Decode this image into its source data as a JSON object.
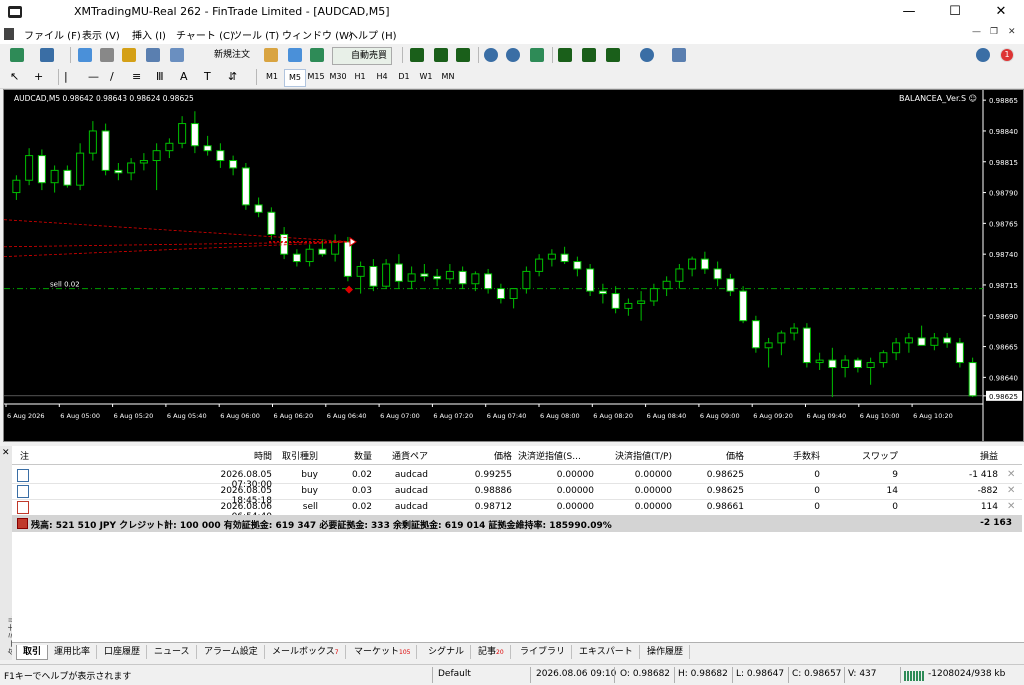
{
  "window": {
    "title": "XMTradingMU-Real 262 - FinTrade Limited - [AUDCAD,M5]",
    "minimize": "—",
    "maximize": "☐",
    "close": "✕"
  },
  "menu": [
    "ファイル (F)",
    "表示 (V)",
    "挿入 (I)",
    "チャート (C)",
    "ツール (T)",
    "ウィンドウ (W)",
    "ヘルプ (H)"
  ],
  "mdi": {
    "min": "—",
    "restore": "❐",
    "close": "✕"
  },
  "toolbar": {
    "new_order": "新規注文",
    "autotrade": "自動売買",
    "notify_count": "1"
  },
  "timeframes": [
    "M1",
    "M5",
    "M15",
    "M30",
    "H1",
    "H4",
    "D1",
    "W1",
    "MN"
  ],
  "timeframe_active": "M5",
  "chart": {
    "info": "AUDCAD,M5  0.98642 0.98643 0.98624 0.98625",
    "ea": "BALANCEA_Ver.S ☺",
    "sell_label": "sell 0.02",
    "current_price": "0.98625",
    "sell_price": 0.98712,
    "price_labels": [
      "0.98865",
      "0.98840",
      "0.98815",
      "0.98790",
      "0.98765",
      "0.98740",
      "0.98715",
      "0.98690",
      "0.98665",
      "0.98640",
      "0.98625"
    ],
    "time_labels": [
      "6 Aug 2026",
      "6 Aug 05:00",
      "6 Aug 05:20",
      "6 Aug 05:40",
      "6 Aug 06:00",
      "6 Aug 06:20",
      "6 Aug 06:40",
      "6 Aug 07:00",
      "6 Aug 07:20",
      "6 Aug 07:40",
      "6 Aug 08:00",
      "6 Aug 08:20",
      "6 Aug 08:40",
      "6 Aug 09:00",
      "6 Aug 09:20",
      "6 Aug 09:40",
      "6 Aug 10:00",
      "6 Aug 10:20"
    ],
    "ohlc": [
      [
        0.9879,
        0.98804,
        0.98784,
        0.988
      ],
      [
        0.988,
        0.98826,
        0.98796,
        0.9882
      ],
      [
        0.9882,
        0.98825,
        0.98792,
        0.98798
      ],
      [
        0.98798,
        0.98812,
        0.9879,
        0.98808
      ],
      [
        0.98808,
        0.98812,
        0.98794,
        0.98796
      ],
      [
        0.98796,
        0.9883,
        0.98792,
        0.98822
      ],
      [
        0.98822,
        0.98848,
        0.98816,
        0.9884
      ],
      [
        0.9884,
        0.98846,
        0.98804,
        0.98808
      ],
      [
        0.98808,
        0.98814,
        0.988,
        0.98806
      ],
      [
        0.98806,
        0.98818,
        0.988,
        0.98814
      ],
      [
        0.98814,
        0.98822,
        0.98808,
        0.98816
      ],
      [
        0.98816,
        0.9883,
        0.98792,
        0.98824
      ],
      [
        0.98824,
        0.98834,
        0.98818,
        0.9883
      ],
      [
        0.9883,
        0.98852,
        0.98826,
        0.98846
      ],
      [
        0.98846,
        0.98856,
        0.98822,
        0.98828
      ],
      [
        0.98828,
        0.98836,
        0.9882,
        0.98824
      ],
      [
        0.98824,
        0.9883,
        0.9881,
        0.98816
      ],
      [
        0.98816,
        0.9882,
        0.98804,
        0.9881
      ],
      [
        0.9881,
        0.98814,
        0.98776,
        0.9878
      ],
      [
        0.9878,
        0.98786,
        0.9877,
        0.98774
      ],
      [
        0.98774,
        0.98778,
        0.98752,
        0.98756
      ],
      [
        0.98756,
        0.98762,
        0.98736,
        0.9874
      ],
      [
        0.9874,
        0.98744,
        0.9873,
        0.98734
      ],
      [
        0.98734,
        0.98748,
        0.9873,
        0.98744
      ],
      [
        0.98744,
        0.98752,
        0.98738,
        0.9874
      ],
      [
        0.9874,
        0.98756,
        0.98734,
        0.9875
      ],
      [
        0.9875,
        0.98754,
        0.98718,
        0.98722
      ],
      [
        0.98722,
        0.98734,
        0.98708,
        0.9873
      ],
      [
        0.9873,
        0.98736,
        0.9871,
        0.98714
      ],
      [
        0.98714,
        0.98736,
        0.98712,
        0.98732
      ],
      [
        0.98732,
        0.9874,
        0.98712,
        0.98718
      ],
      [
        0.98718,
        0.9873,
        0.98712,
        0.98724
      ],
      [
        0.98724,
        0.98732,
        0.98718,
        0.98722
      ],
      [
        0.98722,
        0.98728,
        0.98714,
        0.9872
      ],
      [
        0.9872,
        0.98732,
        0.98716,
        0.98726
      ],
      [
        0.98726,
        0.9873,
        0.98712,
        0.98716
      ],
      [
        0.98716,
        0.98726,
        0.9871,
        0.98724
      ],
      [
        0.98724,
        0.98728,
        0.98708,
        0.98712
      ],
      [
        0.98712,
        0.98716,
        0.987,
        0.98704
      ],
      [
        0.98704,
        0.98712,
        0.98696,
        0.98712
      ],
      [
        0.98712,
        0.9873,
        0.98708,
        0.98726
      ],
      [
        0.98726,
        0.9874,
        0.98722,
        0.98736
      ],
      [
        0.98736,
        0.98744,
        0.9873,
        0.9874
      ],
      [
        0.9874,
        0.98746,
        0.98732,
        0.98734
      ],
      [
        0.98734,
        0.98738,
        0.98722,
        0.98728
      ],
      [
        0.98728,
        0.98732,
        0.98706,
        0.9871
      ],
      [
        0.9871,
        0.98716,
        0.987,
        0.98708
      ],
      [
        0.98708,
        0.98714,
        0.98692,
        0.98696
      ],
      [
        0.98696,
        0.98704,
        0.9869,
        0.987
      ],
      [
        0.987,
        0.9871,
        0.98686,
        0.98702
      ],
      [
        0.98702,
        0.98716,
        0.98698,
        0.98712
      ],
      [
        0.98712,
        0.98722,
        0.98706,
        0.98718
      ],
      [
        0.98718,
        0.98732,
        0.98712,
        0.98728
      ],
      [
        0.98728,
        0.98738,
        0.98722,
        0.98736
      ],
      [
        0.98736,
        0.98742,
        0.98724,
        0.98728
      ],
      [
        0.98728,
        0.98734,
        0.98714,
        0.9872
      ],
      [
        0.9872,
        0.98724,
        0.98706,
        0.9871
      ],
      [
        0.9871,
        0.98714,
        0.98684,
        0.98686
      ],
      [
        0.98686,
        0.9869,
        0.9866,
        0.98664
      ],
      [
        0.98664,
        0.98672,
        0.98648,
        0.98668
      ],
      [
        0.98668,
        0.98678,
        0.98658,
        0.98676
      ],
      [
        0.98676,
        0.98684,
        0.9867,
        0.9868
      ],
      [
        0.9868,
        0.98684,
        0.98648,
        0.98652
      ],
      [
        0.98652,
        0.9866,
        0.98646,
        0.98654
      ],
      [
        0.98654,
        0.98664,
        0.98624,
        0.98648
      ],
      [
        0.98648,
        0.98658,
        0.9864,
        0.98654
      ],
      [
        0.98654,
        0.98656,
        0.98644,
        0.98648
      ],
      [
        0.98648,
        0.98656,
        0.98634,
        0.98652
      ],
      [
        0.98652,
        0.98662,
        0.98648,
        0.9866
      ],
      [
        0.9866,
        0.98672,
        0.98654,
        0.98668
      ],
      [
        0.98668,
        0.98676,
        0.9866,
        0.98672
      ],
      [
        0.98672,
        0.98682,
        0.98666,
        0.98666
      ],
      [
        0.98666,
        0.98676,
        0.98662,
        0.98672
      ],
      [
        0.98672,
        0.98676,
        0.98664,
        0.98668
      ],
      [
        0.98668,
        0.98672,
        0.98648,
        0.98652
      ],
      [
        0.98652,
        0.98656,
        0.98624,
        0.98625
      ]
    ]
  },
  "table": {
    "headers": [
      "注",
      "時間",
      "取引種別",
      "数量",
      "通貨ペア",
      "価格",
      "決済逆指値(S...",
      "決済指値(T/P)",
      "価格",
      "手数料",
      "スワップ",
      "損益"
    ],
    "rows": [
      [
        "",
        "2026.08.05 07:30:00",
        "buy",
        "0.02",
        "audcad",
        "0.99255",
        "0.00000",
        "0.00000",
        "0.98625",
        "0",
        "9",
        "-1 418"
      ],
      [
        "",
        "2026.08.05 18:45:18",
        "buy",
        "0.03",
        "audcad",
        "0.98886",
        "0.00000",
        "0.00000",
        "0.98625",
        "0",
        "14",
        "-882"
      ],
      [
        "",
        "2026.08.06 06:54:40",
        "sell",
        "0.02",
        "audcad",
        "0.98712",
        "0.00000",
        "0.00000",
        "0.98661",
        "0",
        "0",
        "114"
      ]
    ],
    "summary": "残高: 521 510 JPY  クレジット計: 100 000  有効証拠金: 619 347  必要証拠金: 333  余剰証拠金: 619 014  証拠金維持率: 185990.09%",
    "summary_total": "-2 163"
  },
  "terminal_label": "ターミナル",
  "tabs": [
    {
      "label": "取引",
      "badge": ""
    },
    {
      "label": "運用比率",
      "badge": ""
    },
    {
      "label": "口座履歴",
      "badge": ""
    },
    {
      "label": "ニュース",
      "badge": ""
    },
    {
      "label": "アラーム設定",
      "badge": ""
    },
    {
      "label": "メールボックス",
      "badge": "7"
    },
    {
      "label": "マーケット",
      "badge": "105"
    },
    {
      "label": "シグナル",
      "badge": ""
    },
    {
      "label": "記事",
      "badge": "20"
    },
    {
      "label": "ライブラリ",
      "badge": ""
    },
    {
      "label": "エキスパート",
      "badge": ""
    },
    {
      "label": "操作履歴",
      "badge": ""
    }
  ],
  "status": {
    "help": "F1キーでヘルプが表示されます",
    "profile": "Default",
    "time": "2026.08.06 09:10",
    "open": "O: 0.98682",
    "high": "H: 0.98682",
    "low": "L: 0.98647",
    "close": "C: 0.98657",
    "volume": "V: 437",
    "traffic": "-1208024/938 kb"
  },
  "colors": {
    "bull": "#00c000",
    "bear": "#ffffff",
    "sell_line": "#00a000",
    "accent": "#3a6ea5"
  }
}
